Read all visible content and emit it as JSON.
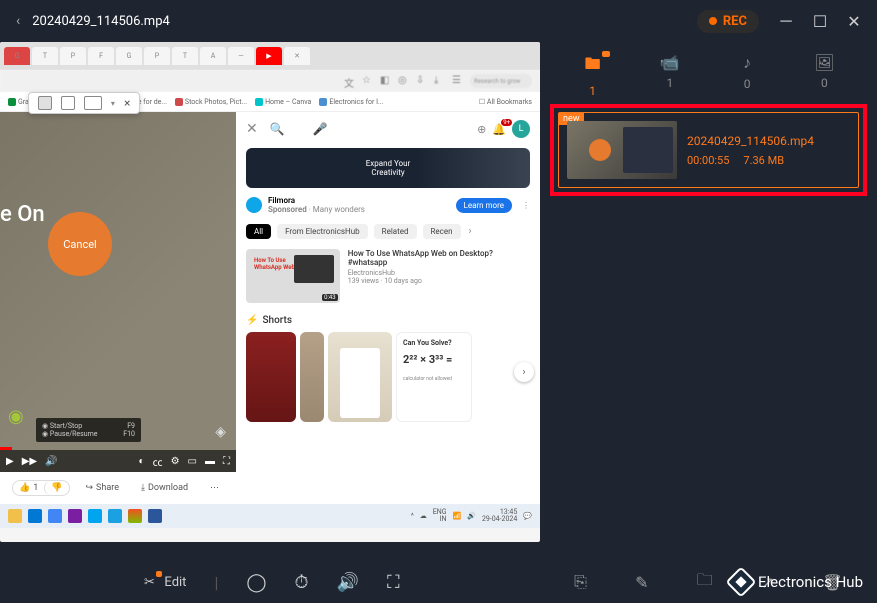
{
  "titlebar": {
    "filename": "20240429_114506.mp4",
    "rec_label": "REC"
  },
  "floatbar": {
    "close": "×"
  },
  "addrbar": {
    "search_placeholder": "Research to grow"
  },
  "bookmarks": {
    "items": [
      {
        "label": "Grammarly Free On...",
        "color": "#0a8f3c"
      },
      {
        "label": "Namer - Free for de...",
        "color": "#222"
      },
      {
        "label": "Stock Photos, Pict...",
        "color": "#d04a4a"
      },
      {
        "label": "Home – Canva",
        "color": "#00c4cc"
      },
      {
        "label": "Electronics for I...",
        "color": "#4a90d0"
      }
    ],
    "all": "All Bookmarks"
  },
  "video": {
    "title_overlay": "e On",
    "cancel": "Cancel",
    "shortcuts": {
      "start": "Start/Stop",
      "start_key": "F9",
      "pause": "Pause/Resume",
      "pause_key": "F10"
    }
  },
  "ytsearch": {
    "avatar": "L"
  },
  "promo": {
    "text": "Expand Your\nCreativity"
  },
  "sponsor": {
    "name": "Filmora",
    "tag": "Sponsored",
    "meta": "· Many wonders",
    "cta": "Learn more"
  },
  "chips": {
    "all": "All",
    "from": "From ElectronicsHub",
    "related": "Related",
    "recent": "Recen"
  },
  "suggestion": {
    "thumb_label": "How To Use\nWhatsApp Web",
    "duration": "0:43",
    "title": "How To Use WhatsApp Web on Desktop? #whatsapp",
    "channel": "ElectronicsHub",
    "views": "139 views · 10 days ago"
  },
  "shorts": {
    "heading": "Shorts",
    "cys": "Can You Solve?",
    "math": "2²² × 3³³ =",
    "caption": "calculator not allowed"
  },
  "actions": {
    "like": "1",
    "share": "Share",
    "download": "Download"
  },
  "taskbar": {
    "lang": "ENG\nIN",
    "time": "13:45\n29-04-2024"
  },
  "categories": {
    "video": {
      "count": "1"
    },
    "camera": {
      "count": "1"
    },
    "audio": {
      "count": "0"
    },
    "image": {
      "count": "0"
    }
  },
  "recording": {
    "new_tag": "new",
    "name": "20240429_114506.mp4",
    "duration": "00:00:55",
    "size": "7.36 MB"
  },
  "bottombar": {
    "edit": "Edit"
  },
  "watermark": {
    "text": "Electronics Hub"
  }
}
